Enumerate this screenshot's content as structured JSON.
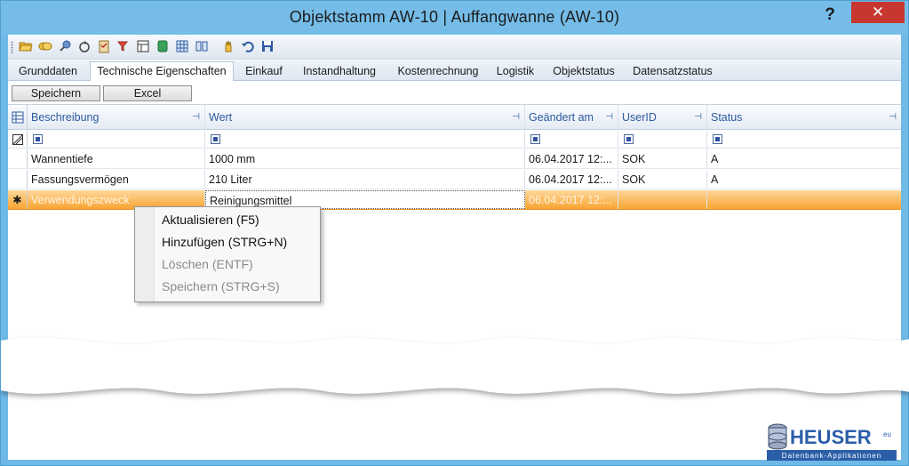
{
  "window": {
    "title": "Objektstamm AW-10 | Auffangwanne (AW-10)",
    "help": "?",
    "close": "✕"
  },
  "toolbar": {
    "icons": [
      "open-folder-icon",
      "copy-icon",
      "pin-icon",
      "refresh-icon",
      "clipboard-icon",
      "filter-icon",
      "layout-icon",
      "database-icon",
      "table-icon",
      "book-icon",
      "hand-icon",
      "undo-icon",
      "save-icon"
    ]
  },
  "tabs": [
    {
      "label": "Grunddaten"
    },
    {
      "label": "Technische Eigenschaften",
      "active": true
    },
    {
      "label": "Einkauf"
    },
    {
      "label": "Instandhaltung"
    },
    {
      "label": "Kostenrechnung"
    },
    {
      "label": "Logistik"
    },
    {
      "label": "Objektstatus"
    },
    {
      "label": "Datensatzstatus"
    }
  ],
  "buttons": {
    "save": "Speichern",
    "excel": "Excel"
  },
  "grid": {
    "columns": [
      "Beschreibung",
      "Wert",
      "Geändert am",
      "UserID",
      "Status"
    ],
    "rows": [
      {
        "beschreibung": "Wannentiefe",
        "wert": "1000 mm",
        "geaendert": "06.04.2017 12:...",
        "user": "SOK",
        "status": "A"
      },
      {
        "beschreibung": "Fassungsvermögen",
        "wert": "210 Liter",
        "geaendert": "06.04.2017 12:...",
        "user": "SOK",
        "status": "A"
      },
      {
        "beschreibung": "Verwendungszweck",
        "wert": "Reinigungsmittel",
        "geaendert": "06.04.2017 12:...",
        "user": "",
        "status": ""
      }
    ],
    "new_row_marker": "✱"
  },
  "context_menu": [
    {
      "label": "Aktualisieren (F5)",
      "enabled": true
    },
    {
      "label": "Hinzufügen (STRG+N)",
      "enabled": true
    },
    {
      "label": "Löschen (ENTF)",
      "enabled": false
    },
    {
      "label": "Speichern (STRG+S)",
      "enabled": false
    }
  ],
  "logo": {
    "name": "HEUSER",
    "suffix": "eu",
    "tagline": "Datenbank-Applikationen"
  },
  "colors": {
    "title_bar": "#75bde8",
    "close_button": "#c7372f",
    "selected_row": "#f8a432",
    "header_text": "#2d5aa0"
  }
}
